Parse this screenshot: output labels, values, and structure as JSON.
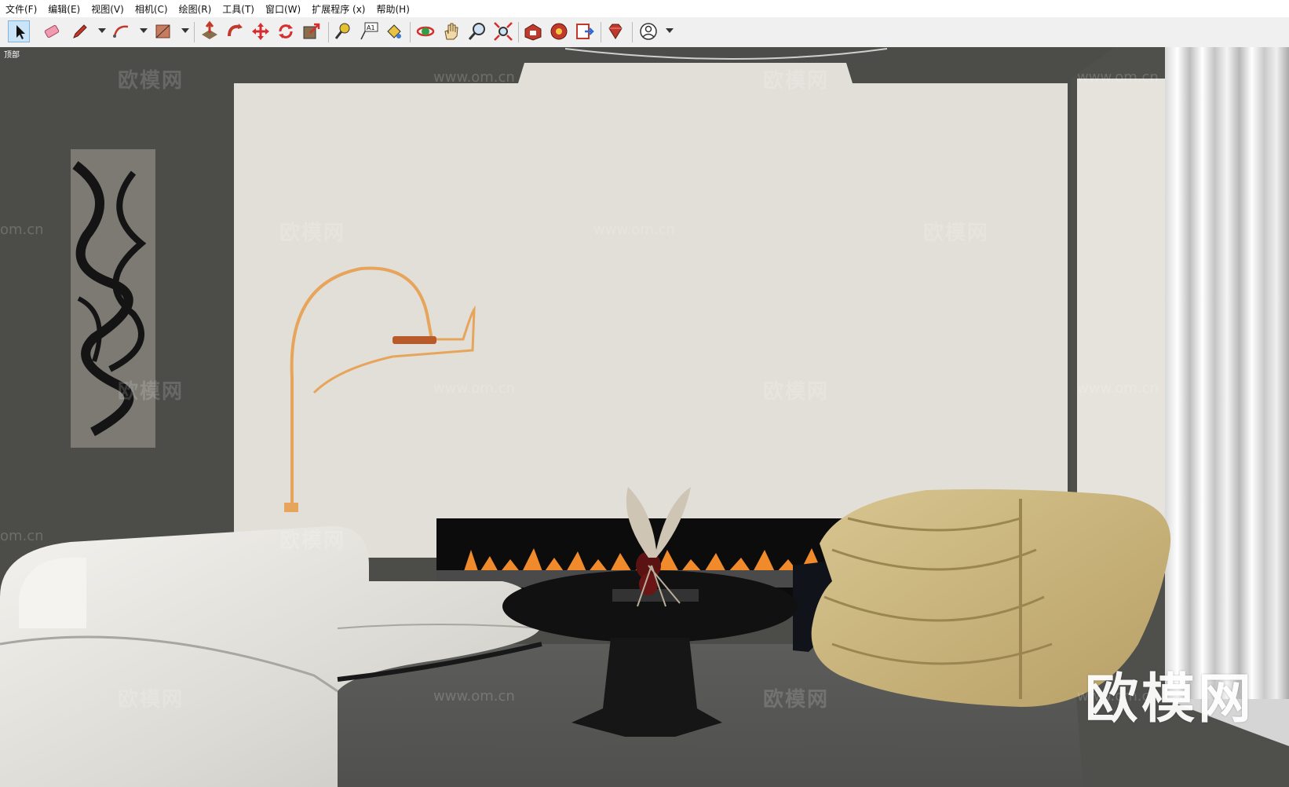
{
  "menu": [
    {
      "label": "文件(F)"
    },
    {
      "label": "编辑(E)"
    },
    {
      "label": "视图(V)"
    },
    {
      "label": "相机(C)"
    },
    {
      "label": "绘图(R)"
    },
    {
      "label": "工具(T)"
    },
    {
      "label": "窗口(W)"
    },
    {
      "label": "扩展程序 (x)"
    },
    {
      "label": "帮助(H)"
    }
  ],
  "toolbar": {
    "tools": [
      {
        "name": "select-icon",
        "active": true
      },
      {
        "name": "eraser-icon"
      },
      {
        "name": "pencil-icon"
      },
      {
        "name": "arc-icon"
      },
      {
        "name": "rectangle-icon"
      },
      {
        "name": "push-pull-icon"
      },
      {
        "name": "follow-me-icon"
      },
      {
        "name": "move-icon"
      },
      {
        "name": "rotate-icon"
      },
      {
        "name": "scale-icon"
      },
      {
        "name": "tape-measure-icon"
      },
      {
        "name": "text-icon"
      },
      {
        "name": "paint-bucket-icon"
      },
      {
        "name": "orbit-icon"
      },
      {
        "name": "pan-icon"
      },
      {
        "name": "zoom-icon"
      },
      {
        "name": "zoom-extents-icon"
      },
      {
        "name": "warehouse-icon"
      },
      {
        "name": "extension-warehouse-icon"
      },
      {
        "name": "send-to-layout-icon"
      },
      {
        "name": "ruby-console-icon"
      },
      {
        "name": "account-icon"
      }
    ]
  },
  "viewport": {
    "scene_label": "顶部",
    "watermark_site": "www.om.cn",
    "watermark_brand": "欧模网",
    "watermark_partial": "om.cn",
    "logo_watermark": "欧模网"
  },
  "colors": {
    "wall_back": "#e1ded7",
    "wall_side": "#4d4d4a",
    "floor": "#585856",
    "sofa": "#e6e4de",
    "chair": "#c9b57b",
    "table": "#131313",
    "lamp": "#e7a55c"
  }
}
